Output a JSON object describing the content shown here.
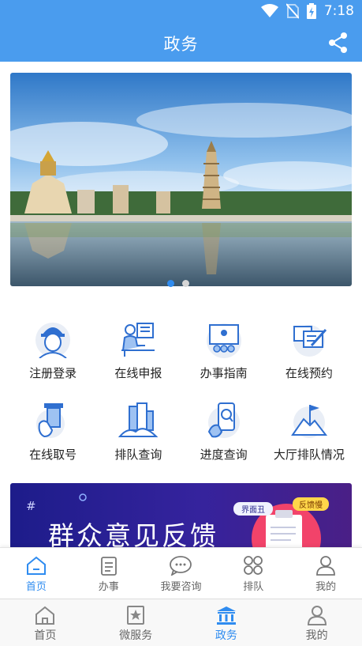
{
  "status_bar": {
    "time": "7:18",
    "icons": [
      "wifi-icon",
      "no-sim-icon",
      "battery-charging-icon"
    ]
  },
  "app_bar": {
    "title": "政务",
    "share_icon": "share-icon"
  },
  "banner": {
    "slide_count": 2,
    "active_slide": 1
  },
  "services": [
    {
      "label": "注册登录",
      "icon": "user-register-icon"
    },
    {
      "label": "在线申报",
      "icon": "online-declare-icon"
    },
    {
      "label": "办事指南",
      "icon": "guide-icon"
    },
    {
      "label": "在线预约",
      "icon": "appointment-icon"
    },
    {
      "label": "在线取号",
      "icon": "take-number-icon"
    },
    {
      "label": "排队查询",
      "icon": "queue-query-icon"
    },
    {
      "label": "进度查询",
      "icon": "progress-query-icon"
    },
    {
      "label": "大厅排队情况",
      "icon": "hall-queue-icon"
    }
  ],
  "promo": {
    "title": "群众意见反馈",
    "hash": "#",
    "tag_left": "界面丑",
    "tag_right": "反馈慢"
  },
  "inner_tabs": [
    {
      "label": "首页",
      "icon": "home-icon",
      "active": true
    },
    {
      "label": "办事",
      "icon": "clipboard-icon",
      "active": false
    },
    {
      "label": "我要咨询",
      "icon": "chat-icon",
      "active": false
    },
    {
      "label": "排队",
      "icon": "grid-icon",
      "active": false
    },
    {
      "label": "我的",
      "icon": "user-icon",
      "active": false
    }
  ],
  "outer_tabs": [
    {
      "label": "首页",
      "icon": "home-icon",
      "active": false
    },
    {
      "label": "微服务",
      "icon": "star-book-icon",
      "active": false
    },
    {
      "label": "政务",
      "icon": "government-building-icon",
      "active": true
    },
    {
      "label": "我的",
      "icon": "user-icon",
      "active": false
    }
  ],
  "colors": {
    "primary": "#4a9cee",
    "active_tab": "#2f8cf0",
    "icon_blue": "#2f6fd0"
  }
}
